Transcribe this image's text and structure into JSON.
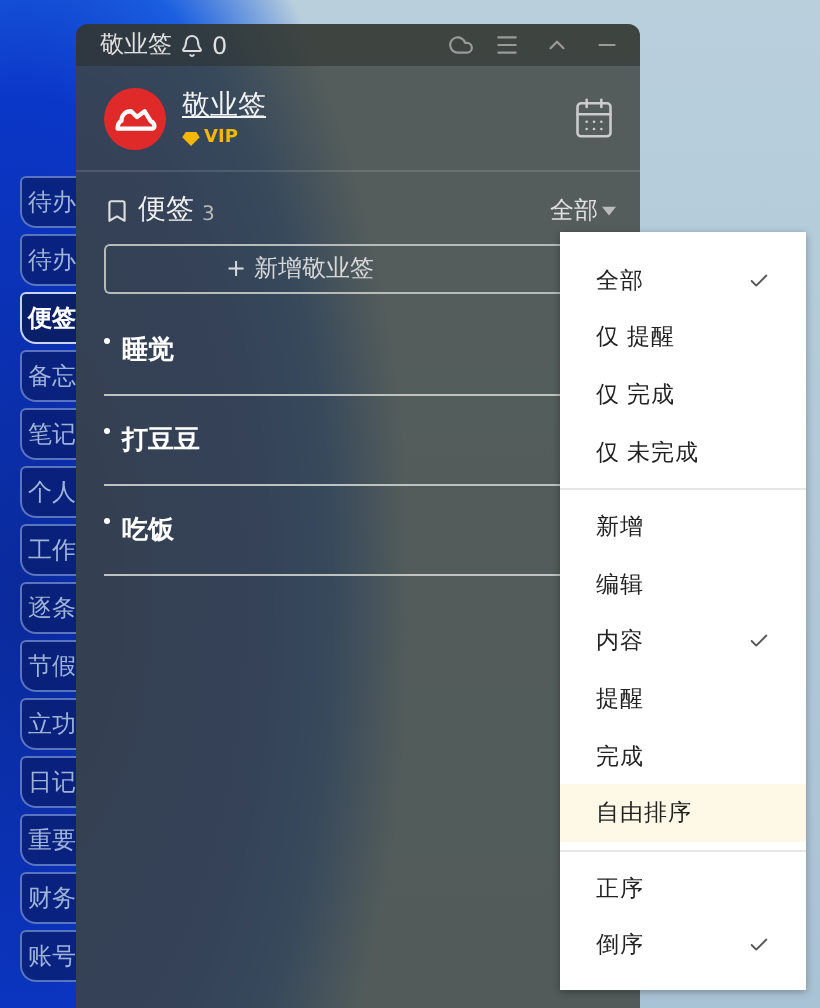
{
  "side_tabs": [
    {
      "label": "待办",
      "selected": false
    },
    {
      "label": "待办",
      "selected": false
    },
    {
      "label": "便签",
      "selected": true
    },
    {
      "label": "备忘",
      "selected": false
    },
    {
      "label": "笔记",
      "selected": false
    },
    {
      "label": "个人",
      "selected": false
    },
    {
      "label": "工作",
      "selected": false
    },
    {
      "label": "逐条",
      "selected": false
    },
    {
      "label": "节假",
      "selected": false
    },
    {
      "label": "立功",
      "selected": false
    },
    {
      "label": "日记",
      "selected": false
    },
    {
      "label": "重要",
      "selected": false
    },
    {
      "label": "财务",
      "selected": false
    },
    {
      "label": "账号",
      "selected": false
    }
  ],
  "window": {
    "title": "敬业签",
    "reminder_count": "0"
  },
  "profile": {
    "name": "敬业签",
    "badge": "VIP"
  },
  "section": {
    "title": "便签",
    "count": "3",
    "filter": "全部"
  },
  "add_button": "+ 新增敬业签",
  "notes": [
    {
      "text": "睡觉"
    },
    {
      "text": "打豆豆"
    },
    {
      "text": "吃饭"
    }
  ],
  "menu": {
    "groups": [
      {
        "items": [
          {
            "label": "全部",
            "checked": true,
            "hovered": false
          },
          {
            "label": "仅 提醒",
            "checked": false,
            "hovered": false
          },
          {
            "label": "仅 完成",
            "checked": false,
            "hovered": false
          },
          {
            "label": "仅 未完成",
            "checked": false,
            "hovered": false
          }
        ]
      },
      {
        "items": [
          {
            "label": "新增",
            "checked": false,
            "hovered": false
          },
          {
            "label": "编辑",
            "checked": false,
            "hovered": false
          },
          {
            "label": "内容",
            "checked": true,
            "hovered": false
          },
          {
            "label": "提醒",
            "checked": false,
            "hovered": false
          },
          {
            "label": "完成",
            "checked": false,
            "hovered": false
          },
          {
            "label": "自由排序",
            "checked": false,
            "hovered": true
          }
        ]
      },
      {
        "items": [
          {
            "label": "正序",
            "checked": false,
            "hovered": false
          },
          {
            "label": "倒序",
            "checked": true,
            "hovered": false
          }
        ]
      }
    ]
  }
}
